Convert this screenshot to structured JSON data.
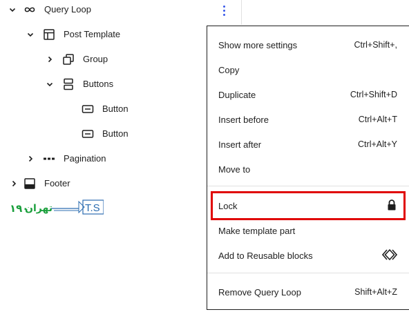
{
  "tree": {
    "items": [
      {
        "label": "Query Loop",
        "icon": "loop-icon"
      },
      {
        "label": "Post Template",
        "icon": "layout-icon"
      },
      {
        "label": "Group",
        "icon": "group-icon"
      },
      {
        "label": "Buttons",
        "icon": "buttons-icon"
      },
      {
        "label": "Button",
        "icon": "button-icon"
      },
      {
        "label": "Button",
        "icon": "button-icon"
      },
      {
        "label": "Pagination",
        "icon": "pagination-icon"
      },
      {
        "label": "Footer",
        "icon": "footer-icon"
      }
    ]
  },
  "menu": {
    "items": [
      {
        "label": "Show more settings",
        "shortcut": "Ctrl+Shift+,"
      },
      {
        "label": "Copy",
        "shortcut": ""
      },
      {
        "label": "Duplicate",
        "shortcut": "Ctrl+Shift+D"
      },
      {
        "label": "Insert before",
        "shortcut": "Ctrl+Alt+T"
      },
      {
        "label": "Insert after",
        "shortcut": "Ctrl+Alt+Y"
      },
      {
        "label": "Move to",
        "shortcut": ""
      },
      {
        "label": "Lock",
        "icon": "lock-icon"
      },
      {
        "label": "Make template part",
        "shortcut": ""
      },
      {
        "label": "Add to Reusable blocks",
        "icon": "reusable-block-icon"
      },
      {
        "label": "Remove Query Loop",
        "shortcut": "Shift+Alt+Z"
      }
    ]
  },
  "watermark": {
    "latin": "T.S",
    "persian": "تهران",
    "number": "۱۹۰"
  },
  "colors": {
    "accent": "#3858e9",
    "highlight": "#e00000",
    "logo_green": "#1a9f3c",
    "logo_blue": "#2b6cb0"
  }
}
